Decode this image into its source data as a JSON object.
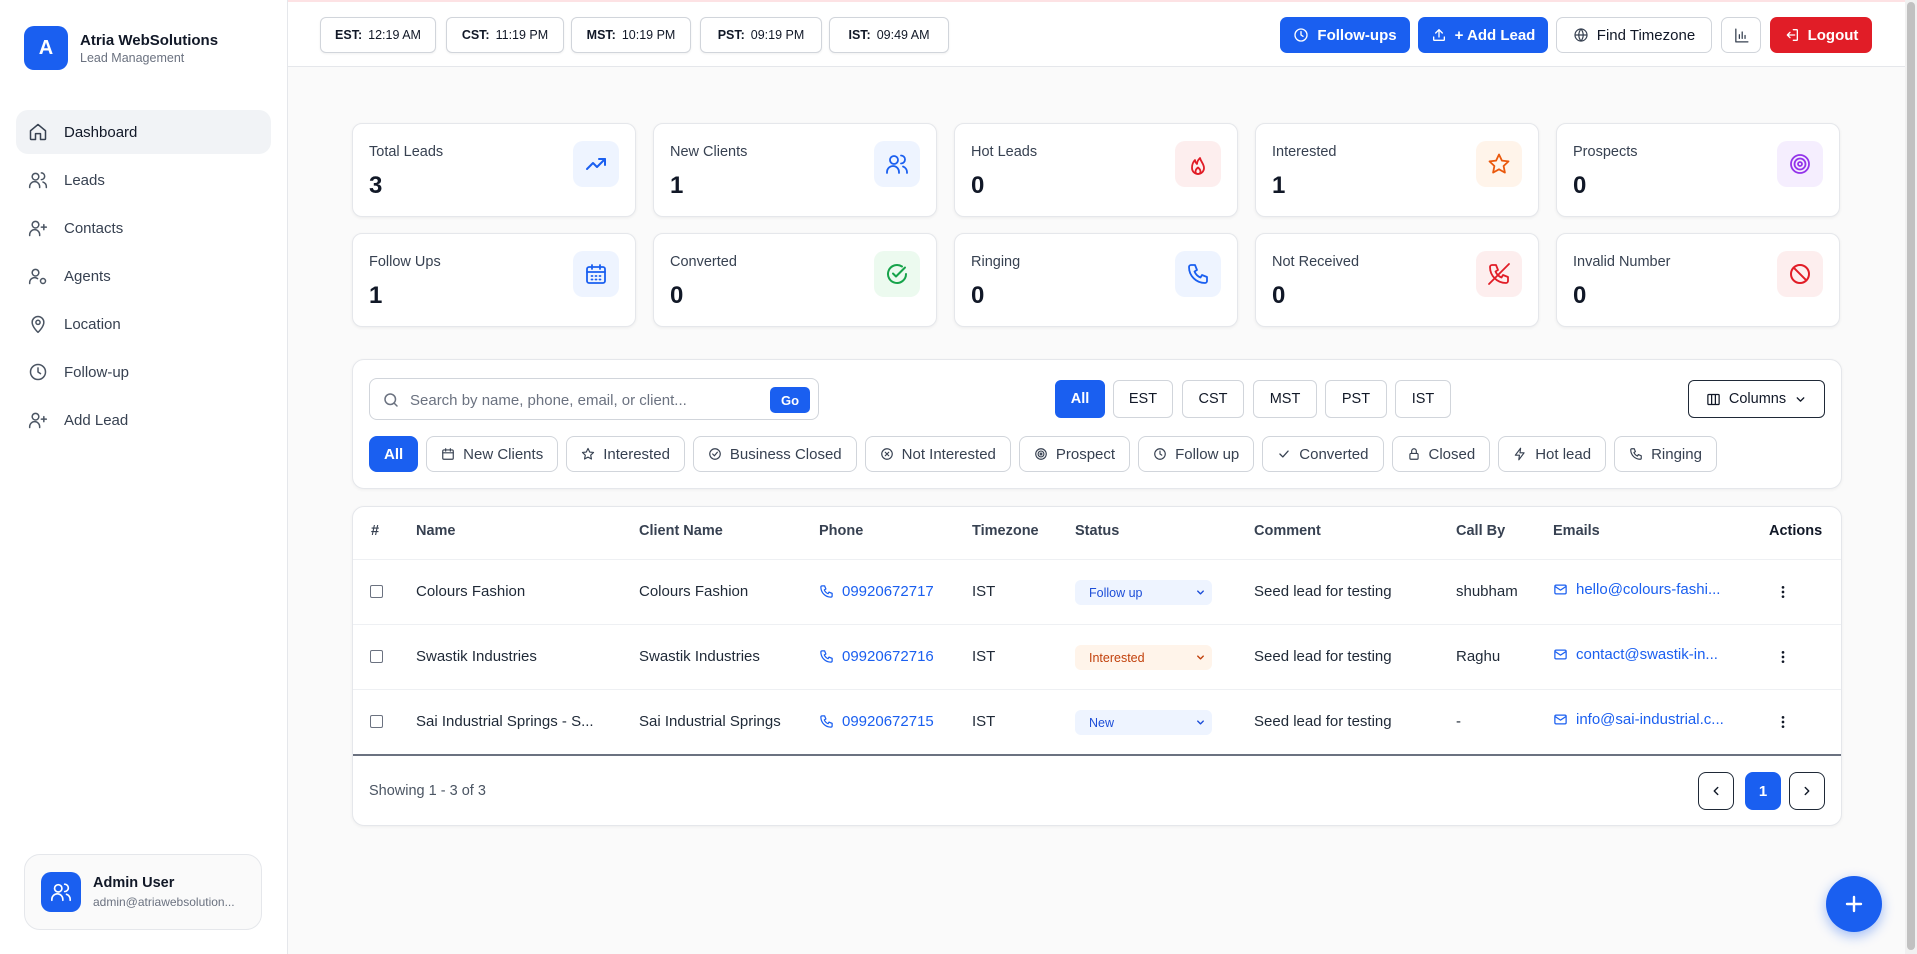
{
  "brand": {
    "logo_letter": "A",
    "name": "Atria WebSolutions",
    "subtitle": "Lead Management"
  },
  "sidebar": {
    "items": [
      {
        "label": "Dashboard",
        "icon": "home-icon",
        "active": true
      },
      {
        "label": "Leads",
        "icon": "users-icon"
      },
      {
        "label": "Contacts",
        "icon": "user-plus-icon"
      },
      {
        "label": "Agents",
        "icon": "user-cog-icon"
      },
      {
        "label": "Location",
        "icon": "map-pin-icon"
      },
      {
        "label": "Follow-up",
        "icon": "clock-icon"
      },
      {
        "label": "Add Lead",
        "icon": "user-plus-icon"
      }
    ]
  },
  "user": {
    "name": "Admin User",
    "email": "admin@atriawebsolution..."
  },
  "topbar": {
    "clocks": [
      {
        "label": "EST:",
        "time": "12:19 AM"
      },
      {
        "label": "CST:",
        "time": "11:19 PM"
      },
      {
        "label": "MST:",
        "time": "10:19 PM"
      },
      {
        "label": "PST:",
        "time": "09:19 PM"
      },
      {
        "label": "IST:",
        "time": "09:49 AM"
      }
    ],
    "followups_label": "Follow-ups",
    "add_lead_label": "+ Add Lead",
    "find_timezone_label": "Find Timezone",
    "logout_label": "Logout"
  },
  "stats": [
    {
      "label": "Total Leads",
      "value": "3",
      "icon": "trending-up-icon",
      "color": "#1a5ff0",
      "bg": "#eef4ff"
    },
    {
      "label": "New Clients",
      "value": "1",
      "icon": "users-icon",
      "color": "#1a5ff0",
      "bg": "#eef4ff"
    },
    {
      "label": "Hot Leads",
      "value": "0",
      "icon": "flame-icon",
      "color": "#e11d27",
      "bg": "#fdeeee"
    },
    {
      "label": "Interested",
      "value": "1",
      "icon": "star-icon",
      "color": "#ea580c",
      "bg": "#fff4ea"
    },
    {
      "label": "Prospects",
      "value": "0",
      "icon": "target-icon",
      "color": "#9333ea",
      "bg": "#f5eefe"
    },
    {
      "label": "Follow Ups",
      "value": "1",
      "icon": "calendar-icon",
      "color": "#1a5ff0",
      "bg": "#eef4ff"
    },
    {
      "label": "Converted",
      "value": "0",
      "icon": "check-circle-icon",
      "color": "#16a34a",
      "bg": "#ecfaef"
    },
    {
      "label": "Ringing",
      "value": "0",
      "icon": "phone-icon",
      "color": "#1a5ff0",
      "bg": "#eef4ff"
    },
    {
      "label": "Not Received",
      "value": "0",
      "icon": "phone-off-icon",
      "color": "#e11d27",
      "bg": "#fdeeee"
    },
    {
      "label": "Invalid Number",
      "value": "0",
      "icon": "ban-icon",
      "color": "#e11d27",
      "bg": "#fdeeee"
    }
  ],
  "search": {
    "placeholder": "Search by name, phone, email, or client...",
    "value": "",
    "go_label": "Go"
  },
  "timezone_filters": [
    "All",
    "EST",
    "CST",
    "MST",
    "PST",
    "IST"
  ],
  "columns_label": "Columns",
  "status_filters": [
    {
      "label": "All",
      "icon": ""
    },
    {
      "label": "New Clients",
      "icon": "calendar-icon"
    },
    {
      "label": "Interested",
      "icon": "star-icon"
    },
    {
      "label": "Business Closed",
      "icon": "check-circle-icon"
    },
    {
      "label": "Not Interested",
      "icon": "x-circle-icon"
    },
    {
      "label": "Prospect",
      "icon": "target-icon"
    },
    {
      "label": "Follow up",
      "icon": "clock-icon"
    },
    {
      "label": "Converted",
      "icon": "check-icon"
    },
    {
      "label": "Closed",
      "icon": "lock-icon"
    },
    {
      "label": "Hot lead",
      "icon": "zap-icon"
    },
    {
      "label": "Ringing",
      "icon": "phone-icon"
    }
  ],
  "table": {
    "columns": [
      "#",
      "Name",
      "Client Name",
      "Phone",
      "Timezone",
      "Status",
      "Comment",
      "Call By",
      "Emails",
      "Actions"
    ],
    "rows": [
      {
        "name": "Colours Fashion",
        "client": "Colours Fashion",
        "phone": "09920672717",
        "timezone": "IST",
        "status": "Follow up",
        "status_color": "#1d4ed8",
        "status_bg": "#eef4ff",
        "comment": "Seed lead for testing",
        "call_by": "shubham",
        "email": "hello@colours-fashi..."
      },
      {
        "name": "Swastik Industries",
        "client": "Swastik Industries",
        "phone": "09920672716",
        "timezone": "IST",
        "status": "Interested",
        "status_color": "#c2410c",
        "status_bg": "#fff4ea",
        "comment": "Seed lead for testing",
        "call_by": "Raghu",
        "email": "contact@swastik-in..."
      },
      {
        "name": "Sai Industrial Springs - S...",
        "client": "Sai Industrial Springs",
        "phone": "09920672715",
        "timezone": "IST",
        "status": "New",
        "status_color": "#1d4ed8",
        "status_bg": "#eef4ff",
        "comment": "Seed lead for testing",
        "call_by": "-",
        "email": "info@sai-industrial.c..."
      }
    ]
  },
  "pagination": {
    "showing": "Showing 1 - 3 of 3",
    "current_page": "1"
  }
}
